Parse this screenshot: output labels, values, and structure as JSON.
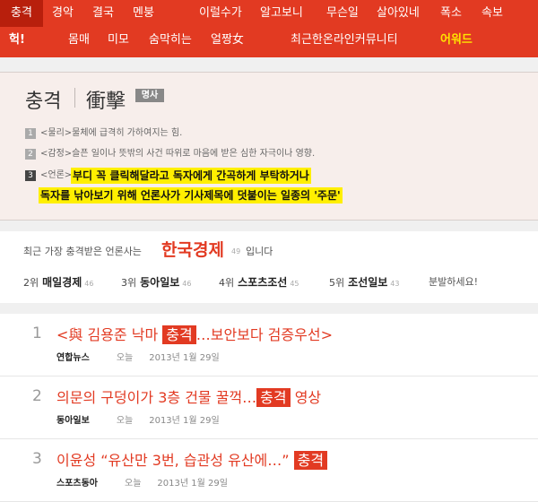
{
  "nav": {
    "row1": [
      "충격",
      "경악",
      "결국",
      "멘붕",
      "이럴수가",
      "알고보니",
      "무슨일",
      "살아있네",
      "폭소",
      "속보"
    ],
    "row2": [
      "헉!",
      "몸매",
      "미모",
      "숨막히는",
      "얼짱女",
      "최근한온라인커뮤니티",
      "어워드"
    ]
  },
  "definition": {
    "word": "충격",
    "hanja": "衝擊",
    "part_of_speech": "명사",
    "senses": [
      {
        "num": "1",
        "text": "<물리>물체에 급격히 가하여지는 힘."
      },
      {
        "num": "2",
        "text": "<감정>슬픈 일이나 뜻밖의 사건 따위로 마음에 받은 심한 자극이나 영향."
      },
      {
        "num": "3",
        "prefix": "<언론>",
        "highlight1": "부디 꼭 클릭해달라고 독자에게 간곡하게 부탁하거나",
        "highlight2": "독자를 낚아보기 위해 언론사가 기사제목에 덧붙이는 일종의 '주문'"
      }
    ]
  },
  "ranking": {
    "intro": "최근 가장 충격받은 언론사는",
    "top_name": "한국경제",
    "top_count": "49",
    "suffix": "입니다",
    "others": [
      {
        "pos": "2위",
        "name": "매일경제",
        "count": "46"
      },
      {
        "pos": "3위",
        "name": "동아일보",
        "count": "46"
      },
      {
        "pos": "4위",
        "name": "스포츠조선",
        "count": "45"
      },
      {
        "pos": "5위",
        "name": "조선일보",
        "count": "43"
      }
    ],
    "rage": "분발하세요!"
  },
  "articles": [
    {
      "no": "1",
      "pre": "<與 김용준 낙마 ",
      "kw": "충격",
      "post": "…보안보다 검증우선>",
      "source": "연합뉴스",
      "day": "오늘",
      "date": "2013년 1월 29일"
    },
    {
      "no": "2",
      "pre": "의문의 구덩이가 3층 건물 꿀꺽…",
      "kw": "충격",
      "post": " 영상",
      "source": "동아일보",
      "day": "오늘",
      "date": "2013년 1월 29일"
    },
    {
      "no": "3",
      "pre": "이윤성 “유산만 3번, 습관성 유산에…” ",
      "kw": "충격",
      "post": "",
      "source": "스포츠동아",
      "day": "오늘",
      "date": "2013년 1월 29일"
    }
  ],
  "colors": {
    "brand": "#e23a22",
    "highlight": "#ffef00"
  }
}
